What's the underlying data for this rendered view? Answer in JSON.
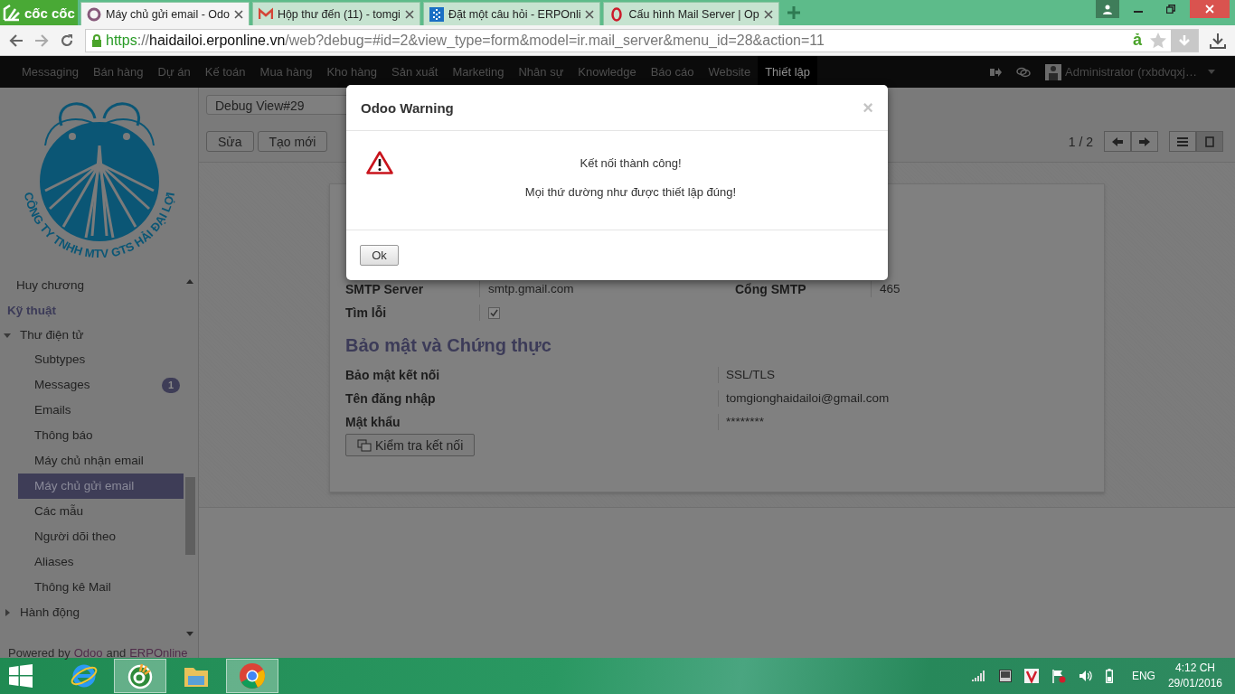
{
  "browser": {
    "logo": "cốc cốc",
    "tabs": [
      {
        "kind": "odoo",
        "title": "Máy chủ gửi email - Odo",
        "selected": true
      },
      {
        "kind": "gmail",
        "title": "Hộp thư đến (11) - tomgi",
        "selected": false
      },
      {
        "kind": "grid",
        "title": "Đặt một câu hỏi - ERPOnli",
        "selected": false
      },
      {
        "kind": "opera",
        "title": "Cấu hình Mail Server | Op",
        "selected": false
      }
    ],
    "address": {
      "scheme": "https",
      "separator": "://",
      "host": "haidailoi.erponline.vn",
      "path": "/web?debug=#id=2&view_type=form&model=ir.mail_server&menu_id=28&action=11"
    },
    "extension_glyph": "ả"
  },
  "top_menu": {
    "items": [
      {
        "label": "Messaging",
        "selected": false
      },
      {
        "label": "Bán hàng",
        "selected": false
      },
      {
        "label": "Dự án",
        "selected": false
      },
      {
        "label": "Kế toán",
        "selected": false
      },
      {
        "label": "Mua hàng",
        "selected": false
      },
      {
        "label": "Kho hàng",
        "selected": false
      },
      {
        "label": "Sản xuất",
        "selected": false
      },
      {
        "label": "Marketing",
        "selected": false
      },
      {
        "label": "Nhân sự",
        "selected": false
      },
      {
        "label": "Knowledge",
        "selected": false
      },
      {
        "label": "Báo cáo",
        "selected": false
      },
      {
        "label": "Website",
        "selected": false
      },
      {
        "label": "Thiết lập",
        "selected": true
      }
    ],
    "user": "Administrator (rxbdvqxj…"
  },
  "sidebar": {
    "logo_text": "CÔNG TY TNHH MTV GTS HẢI ĐẠI LỢI",
    "menu": [
      {
        "kind": "item",
        "label": "Huy chương"
      },
      {
        "kind": "section",
        "label": "Kỹ thuật"
      },
      {
        "kind": "folder",
        "label": "Thư điện tử",
        "expanded": true,
        "children": [
          {
            "label": "Subtypes",
            "selected": false
          },
          {
            "label": "Messages",
            "selected": false,
            "badge": "1"
          },
          {
            "label": "Emails",
            "selected": false
          },
          {
            "label": "Thông báo",
            "selected": false
          },
          {
            "label": "Máy chủ nhận email",
            "selected": false
          },
          {
            "label": "Máy chủ gửi email",
            "selected": true
          },
          {
            "label": "Các mẫu",
            "selected": false
          },
          {
            "label": "Người dõi theo",
            "selected": false
          },
          {
            "label": "Aliases",
            "selected": false
          },
          {
            "label": "Thông kê Mail",
            "selected": false
          }
        ]
      },
      {
        "kind": "folder",
        "label": "Hành động",
        "expanded": false
      }
    ],
    "footer": {
      "prefix": "Powered by",
      "brand": "Odoo",
      "joiner": "and",
      "partner": "ERPOnline"
    }
  },
  "view": {
    "breadcrumb": "Debug View#29",
    "buttons": [
      "Sửa",
      "Tạo mới"
    ],
    "pager": "1 / 2"
  },
  "form": {
    "server_fields": [
      {
        "label": "SMTP Server",
        "value": "smtp.gmail.com"
      },
      {
        "label": "Cổng SMTP",
        "value": "465"
      }
    ],
    "debug": {
      "label": "Tìm lỗi",
      "checked": true
    },
    "section_title": "Bảo mật và Chứng thực",
    "security_fields": [
      {
        "label": "Bảo mật kết nối",
        "value": "SSL/TLS"
      },
      {
        "label": "Tên đăng nhập",
        "value": "tomgionghaidailoi@gmail.com"
      },
      {
        "label": "Mật khẩu",
        "value": "********"
      }
    ],
    "test_button": "Kiểm tra kết nối"
  },
  "dialog": {
    "title": "Odoo Warning",
    "close": "×",
    "lines": [
      "Kết nối thành công!",
      "Mọi thứ dường như được thiết lập đúng!"
    ],
    "button": "Ok"
  },
  "taskbar": {
    "apps": [
      {
        "kind": "ie",
        "active": false
      },
      {
        "kind": "coccoc",
        "active": true
      },
      {
        "kind": "files",
        "active": false
      },
      {
        "kind": "chrome",
        "active": true
      }
    ],
    "language": "ENG",
    "time": "4:12 CH",
    "date": "29/01/2016"
  }
}
